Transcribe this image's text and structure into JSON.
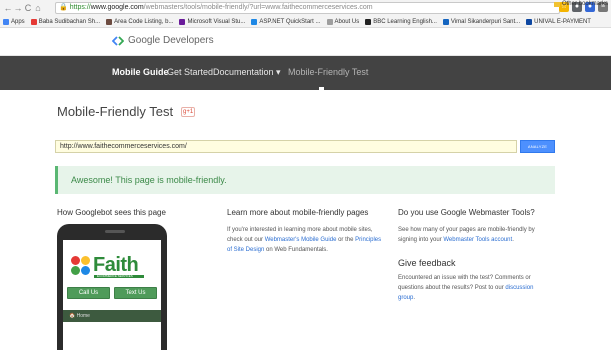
{
  "browser": {
    "back": "←",
    "forward": "→",
    "reload": "C",
    "home": "⌂",
    "url_scheme": "https://",
    "url_host": "www.google.com",
    "url_path": "/webmasters/tools/mobile-friendly/?url=www.faithecommerceservices.com",
    "bookmarks": [
      {
        "label": "Apps",
        "color": "#4285f4"
      },
      {
        "label": "Baba Sudibachan Sh...",
        "color": "#e53935"
      },
      {
        "label": "Area Code Listing, b...",
        "color": "#6d4c41"
      },
      {
        "label": "Microsoft Visual Stu...",
        "color": "#6a1b9a"
      },
      {
        "label": "ASP.NET QuickStart ...",
        "color": "#1e88e5"
      },
      {
        "label": "About Us",
        "color": "#9e9e9e"
      },
      {
        "label": "BBC Learning English...",
        "color": "#212121"
      },
      {
        "label": "Vimal Sikanderpuri Sant...",
        "color": "#1565c0"
      },
      {
        "label": "UNIVAL E-PAYMENT",
        "color": "#0d47a1"
      }
    ],
    "bookmarks_more": "Other bookmarks"
  },
  "devbar": {
    "brand": "Google Developers"
  },
  "nav": {
    "items": [
      {
        "label": "Mobile Guide"
      },
      {
        "label": "Get Started"
      },
      {
        "label": "Documentation ▾"
      },
      {
        "label": "Mobile-Friendly Test"
      }
    ]
  },
  "page": {
    "title": "Mobile-Friendly Test",
    "gplus": "g+1",
    "url_value": "http://www.faithecommerceservices.com/",
    "analyze_label": "ANALYZE",
    "result": "Awesome! This page is mobile-friendly."
  },
  "col1": {
    "heading": "How Googlebot sees this page",
    "logo_text": "Faith",
    "logo_sub": "ECOMMERCE SERVICES",
    "call_label": "Call Us",
    "text_label": "Text Us",
    "home_label": "Home"
  },
  "col2": {
    "heading": "Learn more about mobile-friendly pages",
    "text1": "If you're interested in learning more about mobile sites, check out our ",
    "link1": "Webmaster's Mobile Guide",
    "text2": " or the ",
    "link2": "Principles of Site Design",
    "text3": " on Web Fundamentals."
  },
  "col3": {
    "heading": "Do you use Google Webmaster Tools?",
    "text1": "See how many of your pages are mobile-friendly by signing into your ",
    "link1": "Webmaster Tools account",
    "text2": ".",
    "feedback_heading": "Give feedback",
    "fb_text1": "Encountered an issue with the test? Comments or questions about the results? Post to our ",
    "fb_link": "discussion group",
    "fb_text2": "."
  }
}
